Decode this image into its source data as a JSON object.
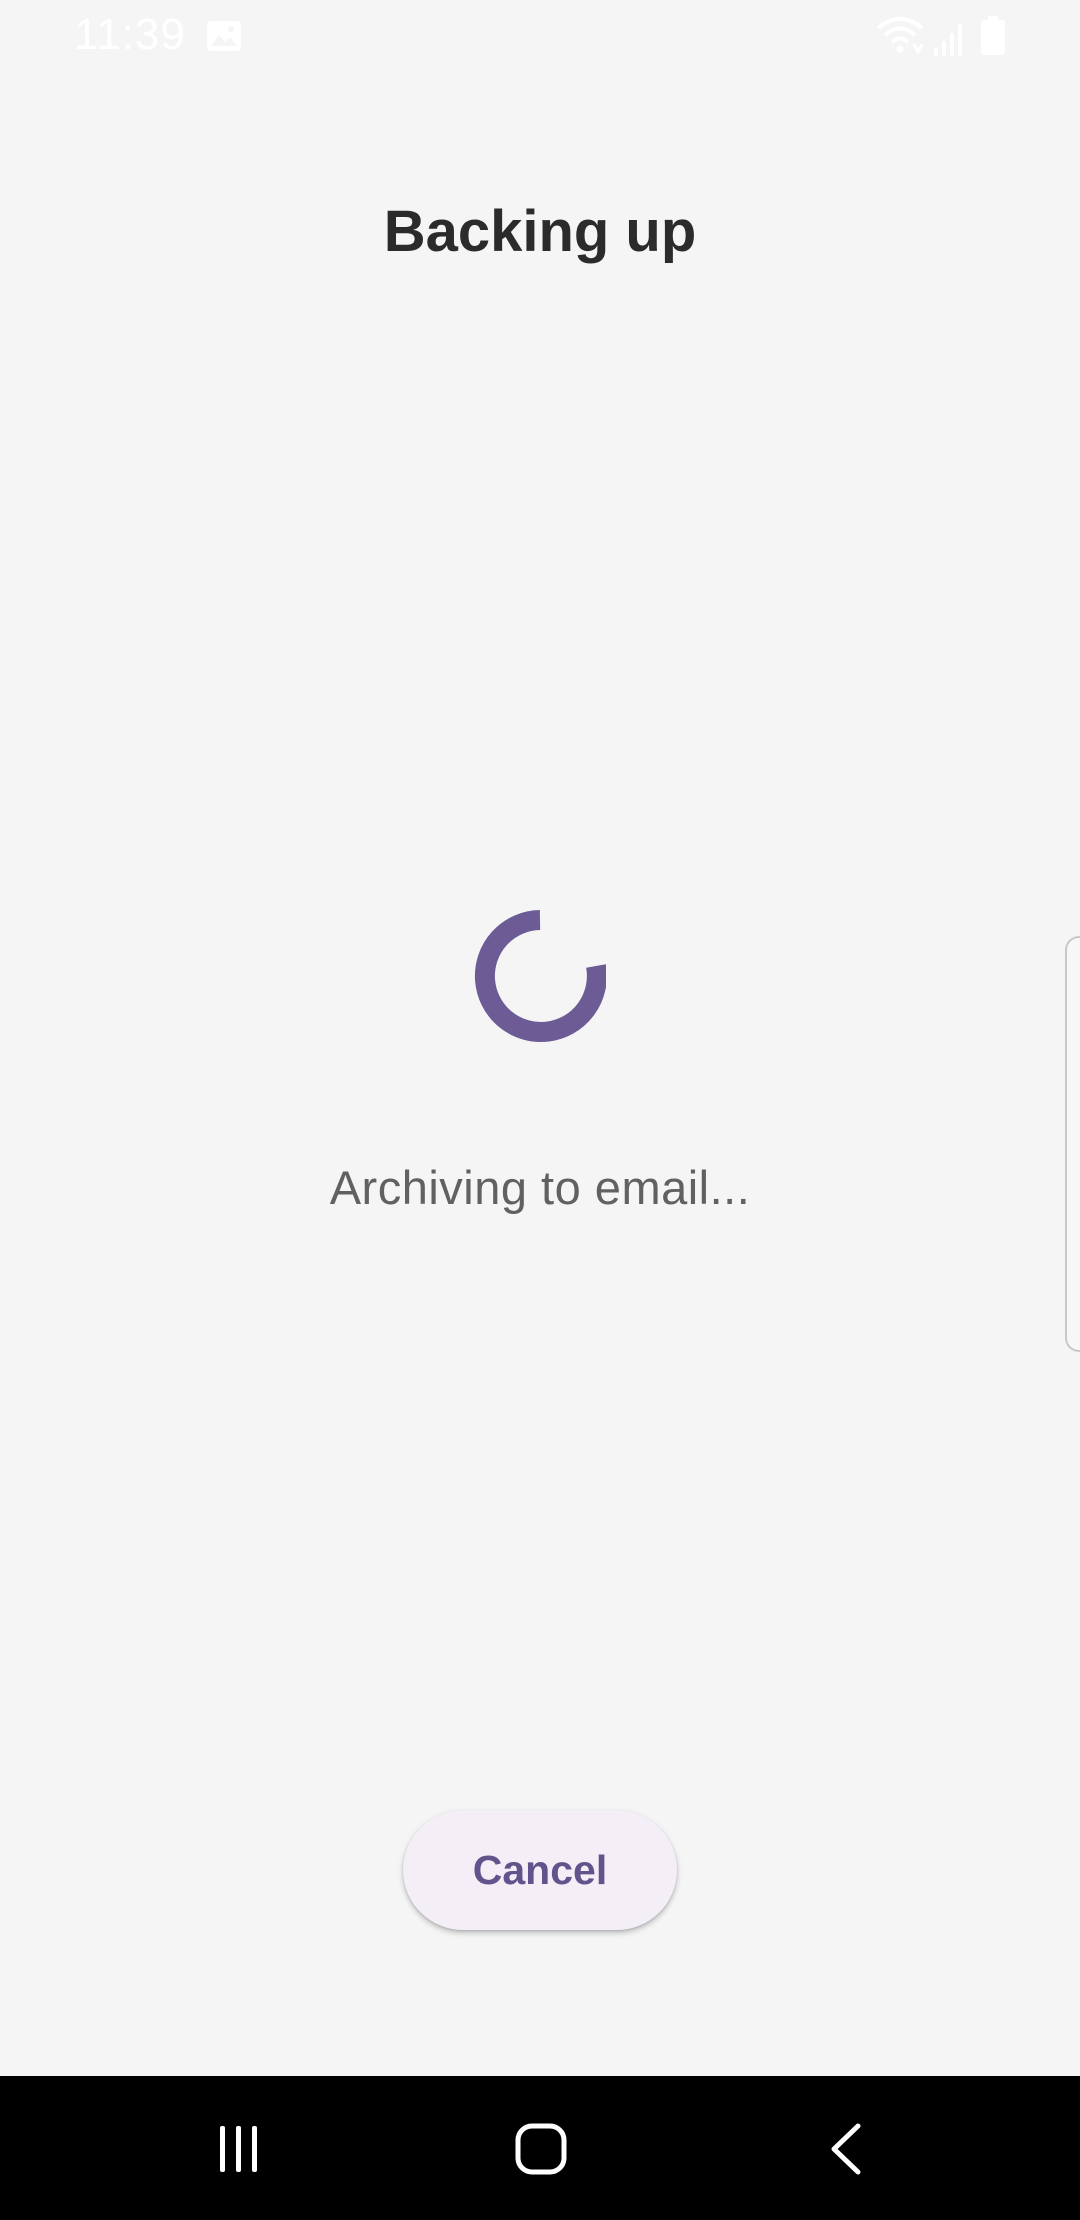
{
  "status_bar": {
    "time": "11:39",
    "icons": [
      "image-icon",
      "wifi-icon",
      "signal-icon",
      "battery-icon"
    ]
  },
  "page": {
    "title": "Backing up",
    "status_text": "Archiving to email...",
    "cancel_label": "Cancel"
  },
  "nav_bar": {
    "icons": [
      "recents-icon",
      "home-icon",
      "back-icon"
    ]
  },
  "colors": {
    "background": "#f5f5f5",
    "accent": "#6c5b94",
    "button_background": "#f4eff6",
    "nav_bar": "#000000"
  }
}
